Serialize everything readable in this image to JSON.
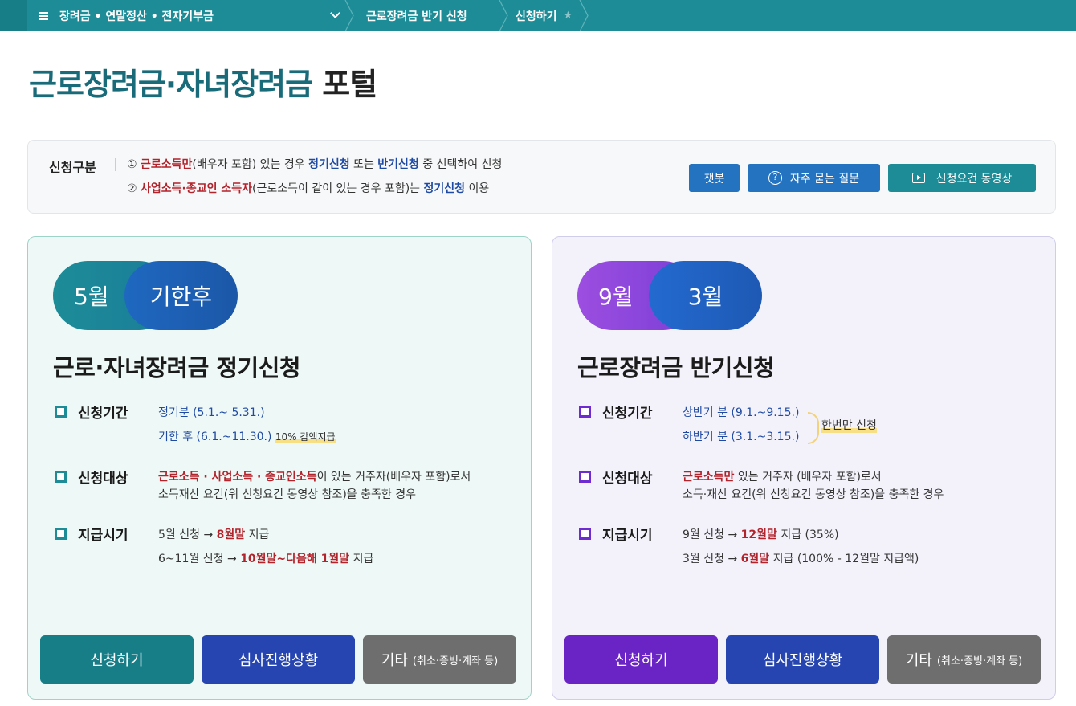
{
  "nav": {
    "menu_label": "장려금 • 연말정산 • 전자기부금",
    "breadcrumb_1": "근로장려금 반기 신청",
    "breadcrumb_2": "신청하기"
  },
  "page_title": {
    "part1": "근로장려금·자녀장려금",
    "part2": "포털"
  },
  "info": {
    "label": "신청구분",
    "line1": {
      "num": "①",
      "red": "근로소득만",
      "t1": "(배우자 포함) 있는 경우 ",
      "blue1": "정기신청",
      "t2": " 또는 ",
      "blue2": "반기신청",
      "t3": " 중 선택하여 신청"
    },
    "line2": {
      "num": "②",
      "red": "사업소득·종교인 소득자",
      "t1": "(근로소득이 같이 있는 경우 포함)는 ",
      "blue": "정기신청",
      "t2": " 이용"
    },
    "buttons": {
      "chatbot": "챗봇",
      "faq": "자주 묻는 질문",
      "video": "신청요건 동영상"
    }
  },
  "left_card": {
    "pill_a": "5월",
    "pill_b": "기한후",
    "title": "근로·자녀장려금 정기신청",
    "period_label": "신청기간",
    "period_1": "정기분 (5.1.~ 5.31.)",
    "period_2": "기한 후 (6.1.~11.30.)",
    "period_2_note": "10% 감액지급",
    "target_label": "신청대상",
    "target_red": "근로소득 · 사업소득 · 종교인소득",
    "target_t1": "이 있는 거주자(배우자 포함)로서",
    "target_t2": "소득재산 요건(위 신청요건 동영상 참조)을 충족한 경우",
    "pay_label": "지급시기",
    "pay_1_a": "5월 신청 → ",
    "pay_1_red": "8월말",
    "pay_1_b": " 지급",
    "pay_2_a": "6~11월 신청 → ",
    "pay_2_red": "10월말~다음해 1월말",
    "pay_2_b": " 지급",
    "btn_apply": "신청하기",
    "btn_status": "심사진행상황",
    "btn_etc": "기타",
    "btn_etc_sub": "(취소·증빙·계좌 등)"
  },
  "right_card": {
    "pill_a": "9월",
    "pill_b": "3월",
    "title": "근로장려금 반기신청",
    "period_label": "신청기간",
    "period_1": "상반기 분 (9.1.~9.15.)",
    "period_2": "하반기 분 (3.1.~3.15.)",
    "period_note": "한번만 신청",
    "target_label": "신청대상",
    "target_red": "근로소득만",
    "target_t1": " 있는 거주자 (배우자 포함)로서",
    "target_t2": "소득·재산 요건(위 신청요건 동영상 참조)을 충족한 경우",
    "pay_label": "지급시기",
    "pay_1_a": "9월 신청 → ",
    "pay_1_red": "12월말",
    "pay_1_b": " 지급 (35%)",
    "pay_2_a": "3월 신청 → ",
    "pay_2_red": "6월말",
    "pay_2_b": " 지급 (100% - 12월말 지급액)",
    "btn_apply": "신청하기",
    "btn_status": "심사진행상황",
    "btn_etc": "기타",
    "btn_etc_sub": "(취소·증빙·계좌 등)"
  },
  "colors": {
    "teal": "#1d8c97",
    "blue": "#2473c0",
    "purple": "#6a23c4",
    "navy": "#2645b0",
    "gray": "#6e6e6e",
    "red": "#b3232c"
  }
}
